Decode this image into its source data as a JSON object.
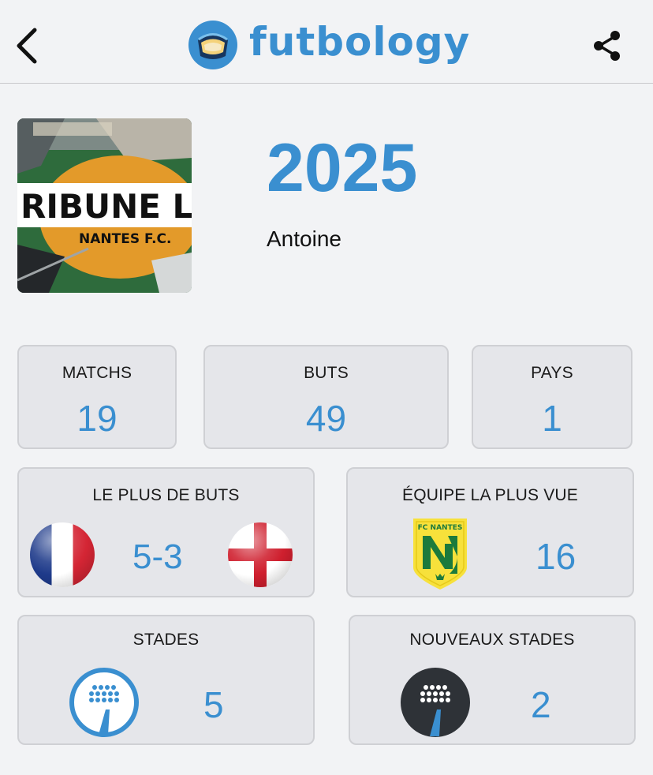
{
  "app": {
    "title": "futbology"
  },
  "header": {
    "back_icon": "chevron-left-icon",
    "share_icon": "share-icon",
    "accent": "#3a8fd0"
  },
  "profile": {
    "year": "2025",
    "user_name": "Antoine",
    "cover_text_1": "RIBUNE LOIR",
    "cover_text_2": "NANTES F.C."
  },
  "stats": {
    "matchs": {
      "label": "MATCHS",
      "value": "19"
    },
    "buts": {
      "label": "BUTS",
      "value": "49"
    },
    "pays": {
      "label": "PAYS",
      "value": "1"
    }
  },
  "most_goals": {
    "label": "LE PLUS DE BUTS",
    "score": "5-3",
    "home_flag": "france-flag",
    "away_flag": "england-flag"
  },
  "most_seen_team": {
    "label": "ÉQUIPE LA PLUS VUE",
    "team_crest_text": "FC NANTES",
    "value": "16"
  },
  "stadiums": {
    "label": "STADES",
    "value": "5",
    "icon": "stadium-icon"
  },
  "new_stadiums": {
    "label": "NOUVEAUX STADES",
    "value": "2",
    "icon": "new-stadium-icon"
  }
}
